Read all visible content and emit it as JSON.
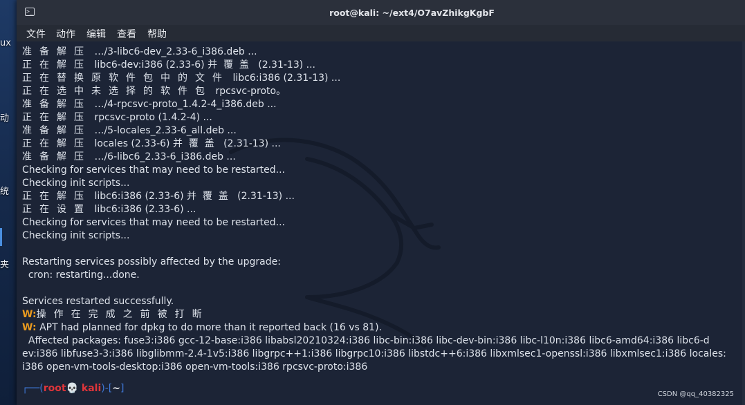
{
  "desktop": {
    "labels": [
      "ux",
      "动",
      "统",
      "夹"
    ]
  },
  "window": {
    "title": "root@kali: ~/ext4/O7avZhikgKgbF"
  },
  "menu": [
    "文件",
    "动作",
    "编辑",
    "查看",
    "帮助"
  ],
  "terminal": {
    "lines": [
      {
        "cj": "准备解压",
        "rest": "…/3-libc6-dev_2.33-6_i386.deb ..."
      },
      {
        "cj": "正在解压",
        "rest": "libc6-dev:i386 (2.33-6) 并  覆  盖   (2.31-13) ..."
      },
      {
        "cj": "正在替换原软件包中的文件",
        "rest": "libc6:i386 (2.31-13) ..."
      },
      {
        "cj": "正在选中未选择的软件包",
        "rest": "rpcsvc-proto。"
      },
      {
        "cj": "准备解压",
        "rest": "…/4-rpcsvc-proto_1.4.2-4_i386.deb ..."
      },
      {
        "cj": "正在解压",
        "rest": "rpcsvc-proto (1.4.2-4) ..."
      },
      {
        "cj": "准备解压",
        "rest": "…/5-locales_2.33-6_all.deb ..."
      },
      {
        "cj": "正在解压",
        "rest": "locales (2.33-6) 并  覆  盖   (2.31-13) ..."
      },
      {
        "cj": "准备解压",
        "rest": "…/6-libc6_2.33-6_i386.deb ..."
      },
      {
        "cj": "",
        "rest": "Checking for services that may need to be restarted..."
      },
      {
        "cj": "",
        "rest": "Checking init scripts..."
      },
      {
        "cj": "正在解压",
        "rest": "libc6:i386 (2.33-6) 并  覆  盖   (2.31-13) ..."
      },
      {
        "cj": "正在设置",
        "rest": "libc6:i386 (2.33-6) ..."
      },
      {
        "cj": "",
        "rest": "Checking for services that may need to be restarted..."
      },
      {
        "cj": "",
        "rest": "Checking init scripts..."
      },
      {
        "cj": "",
        "rest": ""
      },
      {
        "cj": "",
        "rest": "Restarting services possibly affected by the upgrade:"
      },
      {
        "cj": "",
        "rest": "  cron: restarting...done."
      },
      {
        "cj": "",
        "rest": ""
      },
      {
        "cj": "",
        "rest": "Services restarted successfully."
      }
    ],
    "warn_prefix": "W:",
    "warn1": "操作在完成之前被打断",
    "warn2": "APT had planned for dpkg to do more than it reported back (16 vs 81).",
    "affected": [
      "  Affected packages: fuse3:i386 gcc-12-base:i386 libabsl20210324:i386 libc-bin:i386 libc-dev-bin:i386 libc-l10n:i386 libc6-amd64:i386 libc6-d",
      "ev:i386 libfuse3-3:i386 libglibmm-2.4-1v5:i386 libgrpc++1:i386 libgrpc10:i386 libstdc++6:i386 libxmlsec1-openssl:i386 libxmlsec1:i386 locales:",
      "i386 open-vm-tools-desktop:i386 open-vm-tools:i386 rpcsvc-proto:i386"
    ],
    "prompt": {
      "open": "┌──(",
      "user": "root💀 kali",
      "mid": ")-[",
      "dir": "~",
      "close": "]"
    }
  },
  "watermark": "CSDN @qq_40382325"
}
